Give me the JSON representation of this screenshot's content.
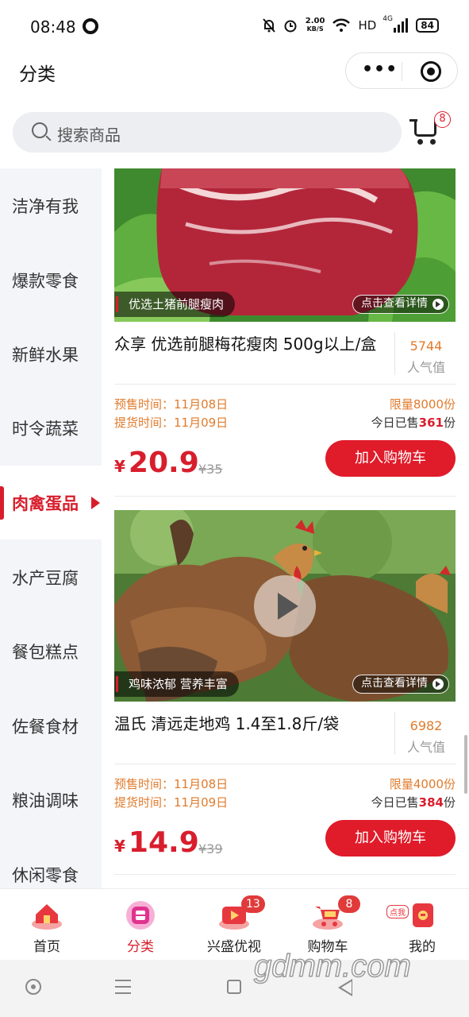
{
  "status_bar": {
    "time": "08:48",
    "speed": "2.00",
    "speed_unit": "KB/S",
    "network": "HD",
    "signal": "4G",
    "battery": "84"
  },
  "header": {
    "title": "分类",
    "more_icon": "more-dots-icon",
    "close_icon": "target-icon"
  },
  "search": {
    "placeholder": "搜索商品",
    "cart_count": "8"
  },
  "sidebar": {
    "items": [
      {
        "label": "洁净有我"
      },
      {
        "label": "爆款零食"
      },
      {
        "label": "新鲜水果"
      },
      {
        "label": "时令蔬菜"
      },
      {
        "label": "肉禽蛋品",
        "active": true
      },
      {
        "label": "水产豆腐"
      },
      {
        "label": "餐包糕点"
      },
      {
        "label": "佐餐食材"
      },
      {
        "label": "粮油调味"
      },
      {
        "label": "休闲零食"
      }
    ]
  },
  "products": [
    {
      "image_tag": "优选土猪前腿瘦肉",
      "detail_link": "点击查看详情",
      "name": "众享 优选前腿梅花瘦肉 500g以上/盒",
      "popularity": "5744",
      "popularity_label": "人气值",
      "presale": "预售时间：11月08日",
      "pickup": "提货时间：11月09日",
      "limit": "限量8000份",
      "sold_prefix": "今日已售",
      "sold": "361",
      "sold_suffix": "份",
      "currency": "¥",
      "price": "20.9",
      "original_price": "¥35",
      "add_button": "加入购物车"
    },
    {
      "image_tag": "鸡味浓郁 营养丰富",
      "detail_link": "点击查看详情",
      "name": "温氏 清远走地鸡 1.4至1.8斤/袋",
      "popularity": "6982",
      "popularity_label": "人气值",
      "presale": "预售时间：11月08日",
      "pickup": "提货时间：11月09日",
      "limit": "限量4000份",
      "sold_prefix": "今日已售",
      "sold": "384",
      "sold_suffix": "份",
      "currency": "¥",
      "price": "14.9",
      "original_price": "¥39",
      "add_button": "加入购物车"
    }
  ],
  "tabbar": {
    "items": [
      {
        "label": "首页",
        "icon": "home-icon"
      },
      {
        "label": "分类",
        "icon": "category-icon",
        "active": true
      },
      {
        "label": "兴盛优视",
        "icon": "video-icon",
        "badge": "13"
      },
      {
        "label": "购物车",
        "icon": "cart-icon",
        "badge": "8"
      },
      {
        "label": "我的",
        "icon": "profile-icon",
        "mini_tag": "点我"
      }
    ]
  },
  "watermark": "gdmm.com",
  "colors": {
    "accent": "#d81e2c",
    "orange": "#e07b2c"
  }
}
